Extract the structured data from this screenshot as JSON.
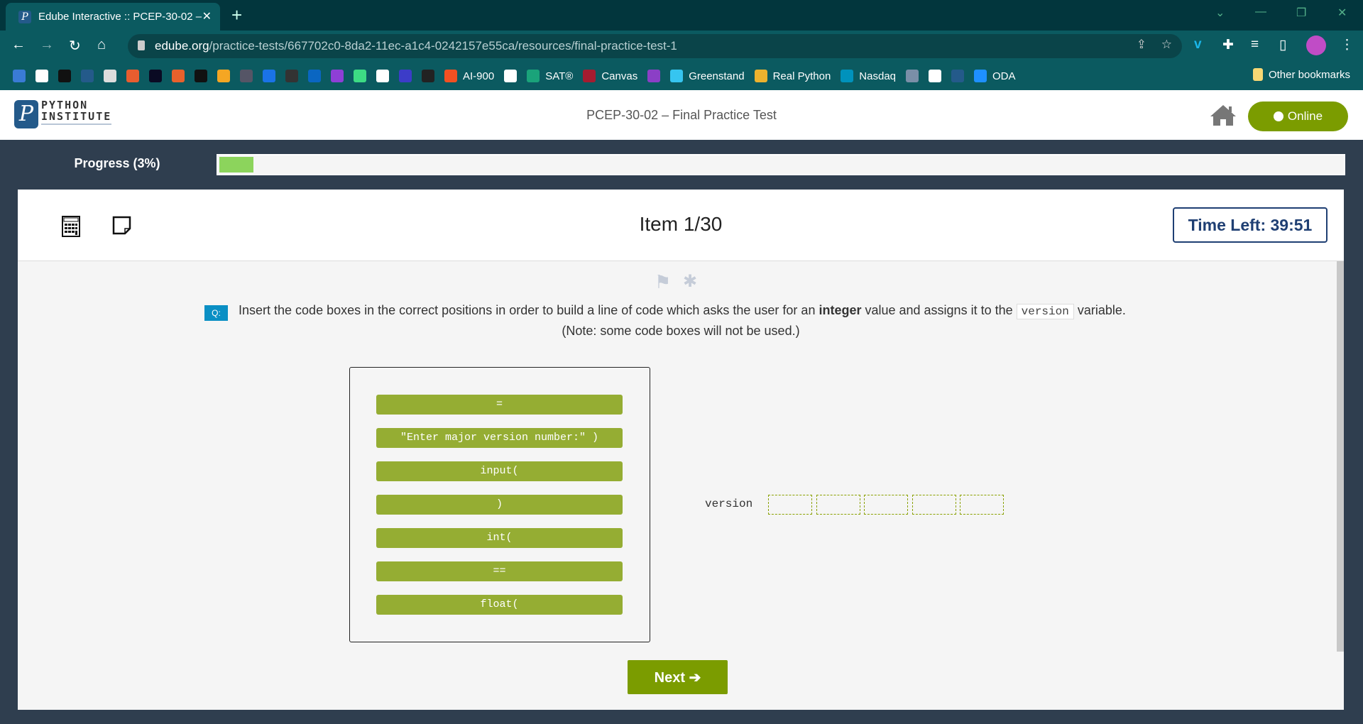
{
  "browser": {
    "tab_title": "Edube Interactive :: PCEP-30-02 –",
    "url_domain": "edube.org",
    "url_path": "/practice-tests/667702c0-8da2-11ec-a1c4-0242157e55ca/resources/final-practice-test-1",
    "bookmarks": [
      {
        "label": "",
        "color": "#3a7bd5"
      },
      {
        "label": "",
        "color": "#fff"
      },
      {
        "label": "",
        "color": "#111"
      },
      {
        "label": "",
        "color": "#245a8a"
      },
      {
        "label": "",
        "color": "#ddd"
      },
      {
        "label": "",
        "color": "#e85d2f"
      },
      {
        "label": "",
        "color": "#0a0a23"
      },
      {
        "label": "",
        "color": "#e8612c"
      },
      {
        "label": "",
        "color": "#111"
      },
      {
        "label": "",
        "color": "#f5a623"
      },
      {
        "label": "",
        "color": "#556"
      },
      {
        "label": "",
        "color": "#1a73e8"
      },
      {
        "label": "",
        "color": "#333"
      },
      {
        "label": "",
        "color": "#0a66c2"
      },
      {
        "label": "",
        "color": "#8e3fd6"
      },
      {
        "label": "",
        "color": "#3ddc84"
      },
      {
        "label": "",
        "color": "#fff"
      },
      {
        "label": "",
        "color": "#3c3cc8"
      },
      {
        "label": "",
        "color": "#222"
      },
      {
        "label": "AI-900",
        "color": "#f25022"
      },
      {
        "label": "",
        "color": "#fff"
      },
      {
        "label": "SAT®",
        "color": "#1aa37a"
      },
      {
        "label": "Canvas",
        "color": "#a51c30"
      },
      {
        "label": "",
        "color": "#8b3fc6"
      },
      {
        "label": "Greenstand",
        "color": "#36c5f0"
      },
      {
        "label": "Real Python",
        "color": "#ecb22e"
      },
      {
        "label": "Nasdaq",
        "color": "#0092bc"
      },
      {
        "label": "",
        "color": "#7a8fa8"
      },
      {
        "label": "",
        "color": "#fff"
      },
      {
        "label": "",
        "color": "#245a8a"
      },
      {
        "label": "ODA",
        "color": "#1e90ff"
      }
    ],
    "other_bookmarks": "Other bookmarks"
  },
  "header": {
    "logo_line1": "PYTHON",
    "logo_line2": "INSTITUTE",
    "title": "PCEP-30-02 – Final Practice Test",
    "status": "Online"
  },
  "progress": {
    "label": "Progress (3%)",
    "percent": 3,
    "fill_color": "#8cd45c"
  },
  "item": {
    "title": "Item 1/30",
    "timer": "Time Left: 39:51"
  },
  "question": {
    "badge": "Q:",
    "text_before": "Insert the code boxes in the correct positions in order to build a line of code which asks the user for an ",
    "bold": "integer",
    "text_middle": " value and assigns it to the ",
    "code": "version",
    "text_after": " variable.",
    "note": "(Note: some code boxes will not be used.)"
  },
  "code_boxes": [
    "=",
    "\"Enter major version number:\" )",
    "input(",
    ")",
    "int(",
    "==",
    "float("
  ],
  "target": {
    "label": "version",
    "slots": 5
  },
  "next_label": "Next ➔",
  "colors": {
    "accent": "#7b9c00",
    "pill": "#95ad33",
    "dark": "#2f3e4f"
  }
}
